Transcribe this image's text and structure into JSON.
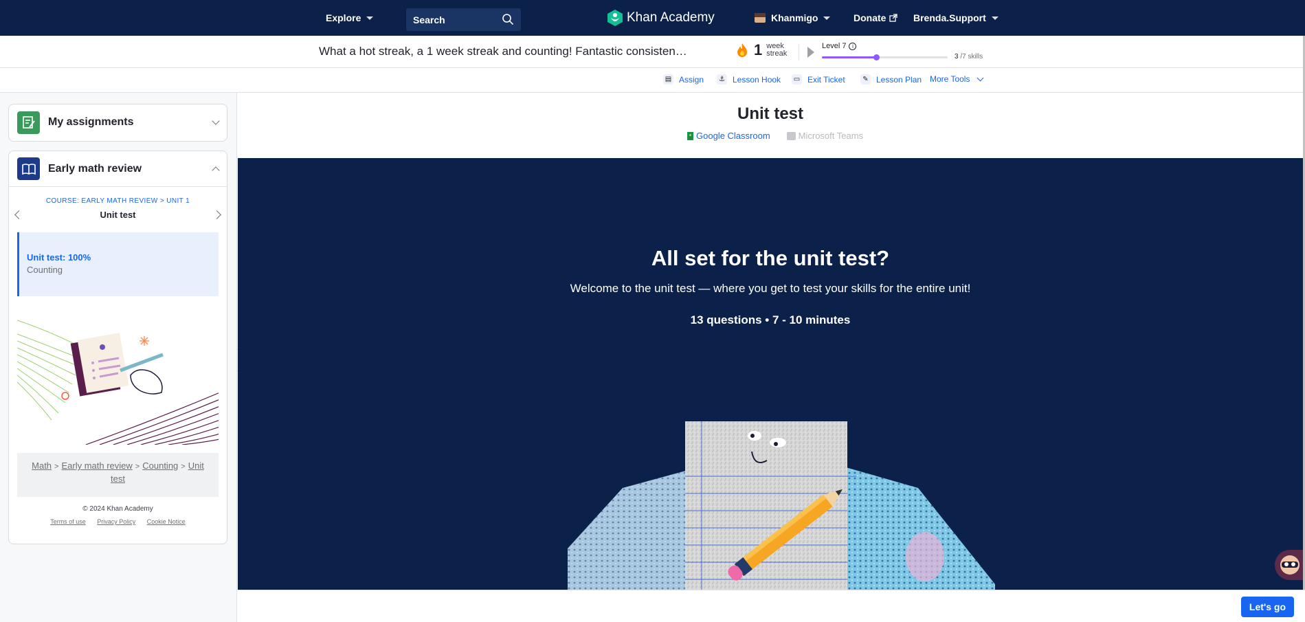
{
  "topnav": {
    "explore": "Explore",
    "search_label": "Search",
    "brand": "Khan Academy",
    "khanmigo": "Khanmigo",
    "donate": "Donate",
    "user": "Brenda.Support"
  },
  "streak": {
    "message": "What a hot streak, a 1 week streak and counting! Fantastic consisten…",
    "count": "1",
    "unit_line1": "week",
    "unit_line2": "streak",
    "level": "Level 7",
    "skills_done": "3",
    "skills_total": "/7 skills",
    "progress_fraction": 0.43
  },
  "tools": {
    "assign": "Assign",
    "lesson_hook": "Lesson Hook",
    "exit_ticket": "Exit Ticket",
    "lesson_plan": "Lesson Plan",
    "more_tools": "More Tools"
  },
  "sidebar": {
    "assignments_title": "My assignments",
    "course_title": "Early math review",
    "breadcrumb": "COURSE: EARLY MATH REVIEW > UNIT 1",
    "unit_label": "Unit test",
    "active_item_title": "Unit test: 100%",
    "active_item_sub": "Counting",
    "path": [
      "Math",
      "Early math review",
      "Counting",
      "Unit test"
    ],
    "copyright": "© 2024 Khan Academy",
    "legal": [
      "Terms of use",
      "Privacy Policy",
      "Cookie Notice"
    ]
  },
  "main": {
    "title": "Unit test",
    "share_google": "Google Classroom",
    "share_teams": "Microsoft Teams",
    "hero_heading": "All set for the unit test?",
    "hero_sub": "Welcome to the unit test — where you get to test your skills for the entire unit!",
    "hero_meta": "13 questions • 7 - 10 minutes",
    "cta": "Let's go"
  },
  "colors": {
    "navy": "#0b2149",
    "accent_blue": "#1865f2",
    "level_purple": "#9059ff"
  }
}
